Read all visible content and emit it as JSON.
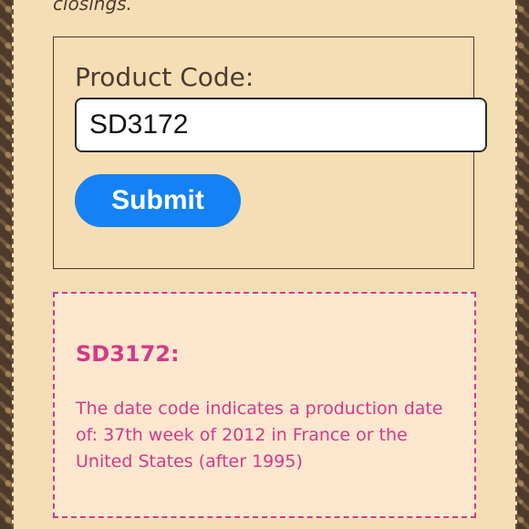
{
  "top_note": "closings.",
  "form": {
    "label": "Product Code:",
    "input_value": "SD3172",
    "submit_label": "Submit"
  },
  "result": {
    "title": "SD3172:",
    "text": "The date code indicates a production date of: 37th week of 2012 in France or the United States (after 1995)"
  },
  "colors": {
    "panel_bg": "#f6deb4",
    "submit_bg": "#1482f6",
    "result_accent": "#d6388a",
    "result_bg": "#fde8cf"
  }
}
